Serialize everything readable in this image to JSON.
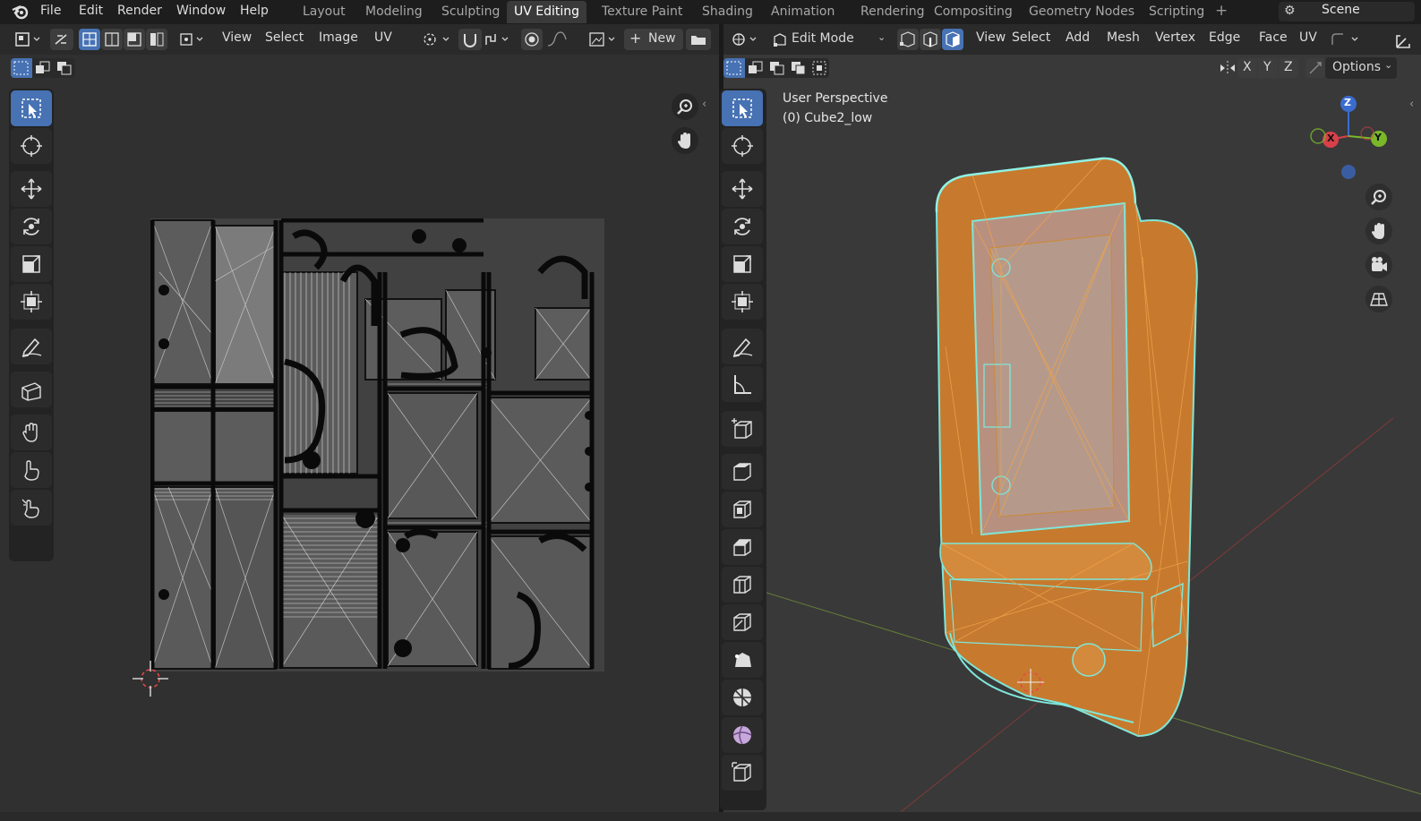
{
  "topbar": {
    "menus": [
      "File",
      "Edit",
      "Render",
      "Window",
      "Help"
    ],
    "workspaces": [
      "Layout",
      "Modeling",
      "Sculpting",
      "UV Editing",
      "Texture Paint",
      "Shading",
      "Animation",
      "Rendering",
      "Compositing",
      "Geometry Nodes",
      "Scripting"
    ],
    "active_workspace": "UV Editing",
    "add_tab": "+",
    "scene": "Scene"
  },
  "uv_editor": {
    "menus": [
      "View",
      "Select",
      "Image",
      "UV"
    ],
    "new_label": "New",
    "new_plus": "+"
  },
  "viewport": {
    "mode": "Edit Mode",
    "menus": [
      "View",
      "Select",
      "Add",
      "Mesh",
      "Vertex",
      "Edge",
      "Face",
      "UV"
    ],
    "axis_x": "X",
    "axis_y": "Y",
    "axis_z": "Z",
    "options": "Options",
    "overlay_title": "User Perspective",
    "overlay_object": "(0) Cube2_low",
    "gizmo": {
      "x": "X",
      "y": "Y",
      "z": "Z"
    }
  },
  "colors": {
    "accent": "#4772b3",
    "mesh_orange": "#d9822b",
    "mesh_edge": "#7fe6d9",
    "axis_red": "#d9404a",
    "axis_green": "#7ab82a",
    "axis_blue": "#3a6ccf"
  }
}
